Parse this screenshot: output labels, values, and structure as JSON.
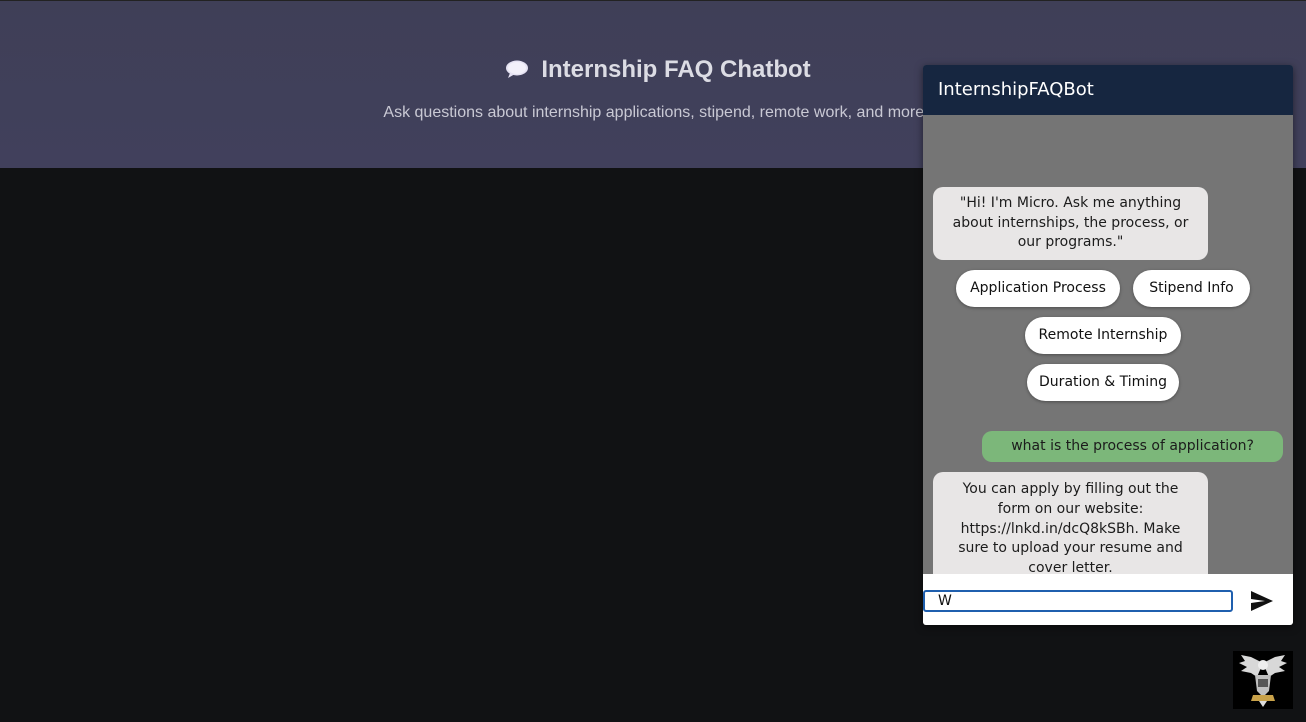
{
  "header": {
    "title": "Internship FAQ Chatbot",
    "subtitle": "Ask questions about internship applications, stipend, remote work, and more!",
    "icon": "speech-bubble-icon"
  },
  "chat": {
    "title": "InternshipFAQBot",
    "greeting": "\"Hi! I'm Micro. Ask me anything about internships, the process, or our programs.\"",
    "quick_replies": [
      "Application Process",
      "Stipend Info",
      "Remote Internship",
      "Duration & Timing"
    ],
    "user_message": "what is the process of application?",
    "bot_reply": "You can apply by filling out the form on our website: https://lnkd.in/dcQ8kSBh. Make sure to upload your resume and cover letter.",
    "input_value": "W",
    "send_icon": "send-icon"
  },
  "colors": {
    "header_bg": "#162640",
    "user_bubble": "#7cb77a",
    "bot_bubble": "#e8e6e6",
    "chat_bg": "#757575",
    "input_border": "#1f5fae"
  }
}
